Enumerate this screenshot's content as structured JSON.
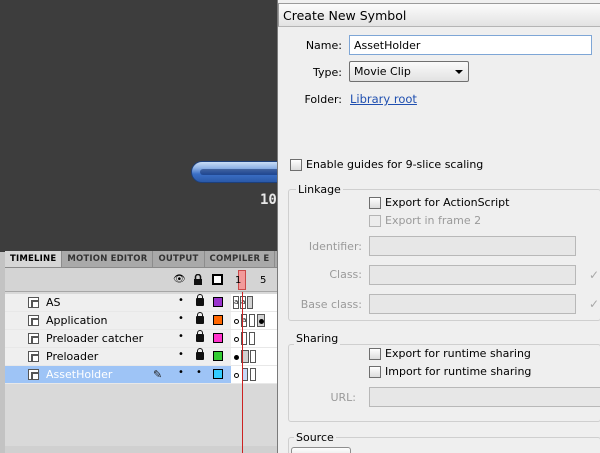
{
  "stage": {
    "counter_text": "10"
  },
  "timeline": {
    "tabs": [
      "TIMELINE",
      "MOTION EDITOR",
      "OUTPUT",
      "COMPILER E"
    ],
    "ruler": {
      "frame1": "1",
      "frame5": "5"
    },
    "layers": [
      {
        "name": "AS",
        "color": "#9933cc",
        "selected": false
      },
      {
        "name": "Application",
        "color": "#ff6600",
        "selected": false
      },
      {
        "name": "Preloader catcher",
        "color": "#ff33cc",
        "selected": false
      },
      {
        "name": "Preloader",
        "color": "#33cc33",
        "selected": false
      },
      {
        "name": "AssetHolder",
        "color": "#33ccff",
        "selected": true
      }
    ],
    "frame_letters": {
      "as1": "a",
      "as2": "a",
      "app": "a"
    }
  },
  "dialog": {
    "title": "Create New Symbol",
    "name_label": "Name:",
    "name_value": "AssetHolder",
    "type_label": "Type:",
    "type_value": "Movie Clip",
    "folder_label": "Folder:",
    "folder_link": "Library root",
    "nine_slice_label": "Enable guides for 9-slice scaling",
    "linkage": {
      "title": "Linkage",
      "export_as": "Export for ActionScript",
      "export_frame2": "Export in frame 2",
      "identifier_label": "Identifier:",
      "class_label": "Class:",
      "base_class_label": "Base class:"
    },
    "sharing": {
      "title": "Sharing",
      "export_runtime": "Export for runtime sharing",
      "import_runtime": "Import for runtime sharing",
      "url_label": "URL:"
    },
    "source": {
      "title": "Source"
    }
  }
}
